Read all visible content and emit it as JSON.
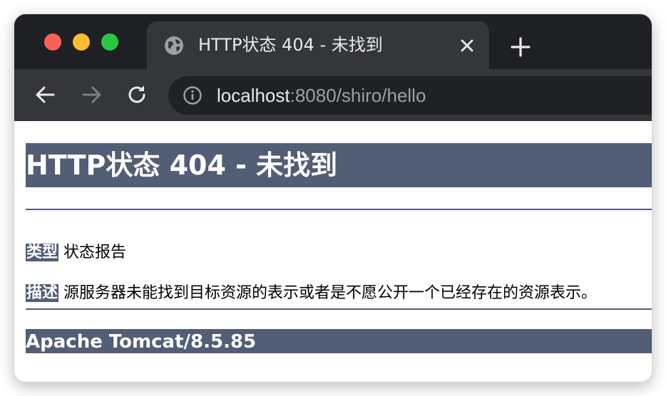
{
  "browser": {
    "tab_title": "HTTP状态 404 - 未找到",
    "url_host": "localhost",
    "url_path": ":8080/shiro/hello",
    "tab_icon": "globe-icon",
    "close_icon": "close-icon",
    "new_tab_icon": "plus-icon",
    "back_icon": "back-arrow-icon",
    "forward_icon": "forward-arrow-icon",
    "reload_icon": "reload-icon",
    "site_info_icon": "info-icon"
  },
  "page": {
    "heading": "HTTP状态 404 - 未找到",
    "type_label": "类型",
    "type_value": " 状态报告",
    "description_label": "描述",
    "description_value": " 源服务器未能找到目标资源的表示或者是不愿公开一个已经存在的资源表示。",
    "server": "Apache Tomcat/8.5.85"
  },
  "colors": {
    "accent": "#525d76",
    "titlebar": "#1f2023",
    "tab_bg": "#35363a"
  }
}
